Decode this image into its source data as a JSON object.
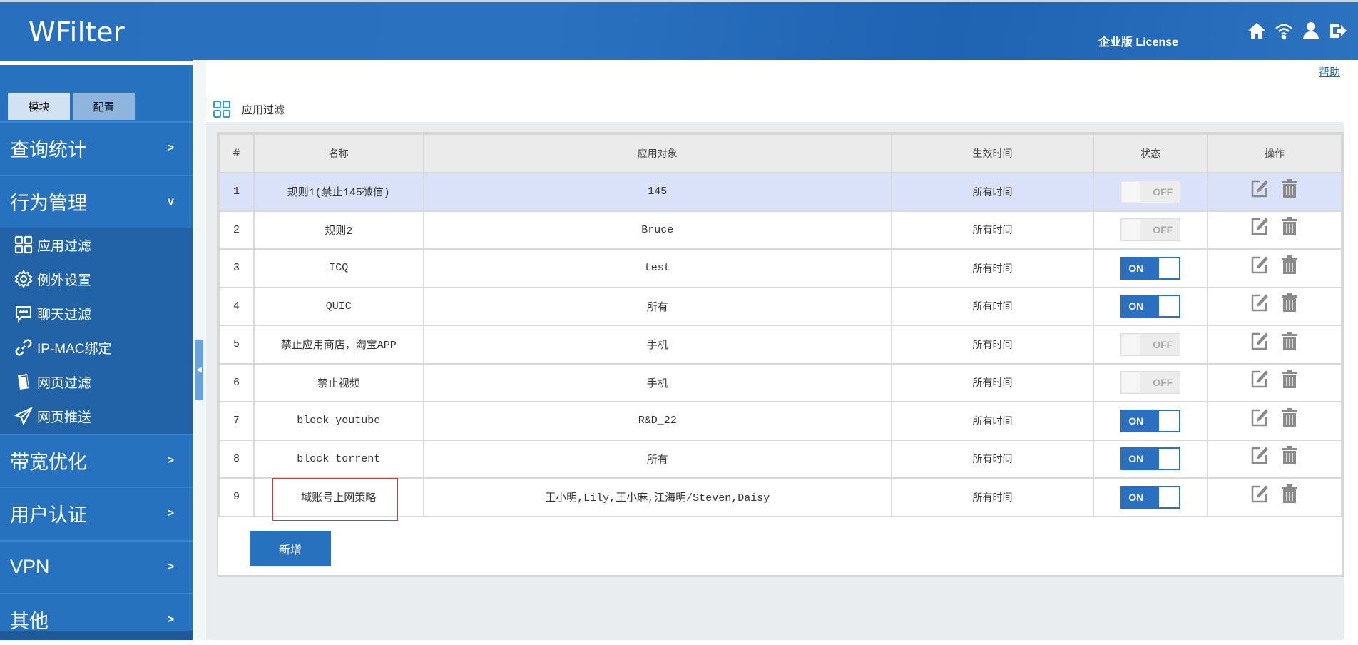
{
  "header": {
    "logo": "WFilter",
    "license": "企业版 License",
    "icons": [
      "home-icon",
      "wifi-icon",
      "user-icon",
      "logout-icon"
    ]
  },
  "sidebar": {
    "tabs": [
      "模块",
      "配置"
    ],
    "menus": [
      {
        "label": "查询统计",
        "chev": ">"
      },
      {
        "label": "行为管理",
        "chev": "v"
      },
      {
        "label": "带宽优化",
        "chev": ">"
      },
      {
        "label": "用户认证",
        "chev": ">"
      },
      {
        "label": "VPN",
        "chev": ">"
      },
      {
        "label": "其他",
        "chev": ">"
      }
    ],
    "submenu": [
      {
        "label": "应用过滤",
        "icon": "grid-icon"
      },
      {
        "label": "例外设置",
        "icon": "gear-icon"
      },
      {
        "label": "聊天过滤",
        "icon": "chat-icon"
      },
      {
        "label": "IP-MAC绑定",
        "icon": "link-icon"
      },
      {
        "label": "网页过滤",
        "icon": "page-icon"
      },
      {
        "label": "网页推送",
        "icon": "send-icon"
      }
    ]
  },
  "help": "帮助",
  "page_title": "应用过滤",
  "table": {
    "headers": [
      "#",
      "名称",
      "应用对象",
      "生效时间",
      "状态",
      "操作"
    ],
    "rows": [
      {
        "n": "1",
        "name": "规则1(禁止145微信)",
        "target": "145",
        "time": "所有时间",
        "status": "OFF"
      },
      {
        "n": "2",
        "name": "规则2",
        "target": "Bruce",
        "time": "所有时间",
        "status": "OFF"
      },
      {
        "n": "3",
        "name": "ICQ",
        "target": "test",
        "time": "所有时间",
        "status": "ON"
      },
      {
        "n": "4",
        "name": "QUIC",
        "target": "所有",
        "time": "所有时间",
        "status": "ON"
      },
      {
        "n": "5",
        "name": "禁止应用商店，淘宝APP",
        "target": "手机",
        "time": "所有时间",
        "status": "OFF"
      },
      {
        "n": "6",
        "name": "禁止视频",
        "target": "手机",
        "time": "所有时间",
        "status": "OFF"
      },
      {
        "n": "7",
        "name": "block youtube",
        "target": "R&D_22",
        "time": "所有时间",
        "status": "ON"
      },
      {
        "n": "8",
        "name": "block torrent",
        "target": "所有",
        "time": "所有时间",
        "status": "ON"
      },
      {
        "n": "9",
        "name": "域账号上网策略",
        "target": "王小明,Lily,王小麻,江海明/Steven,Daisy",
        "time": "所有时间",
        "status": "ON"
      }
    ]
  },
  "add_button": "新增",
  "colors": {
    "brand": "#2672bf",
    "highlight_row": "#d9e2f8",
    "annotation": "#e53333"
  }
}
